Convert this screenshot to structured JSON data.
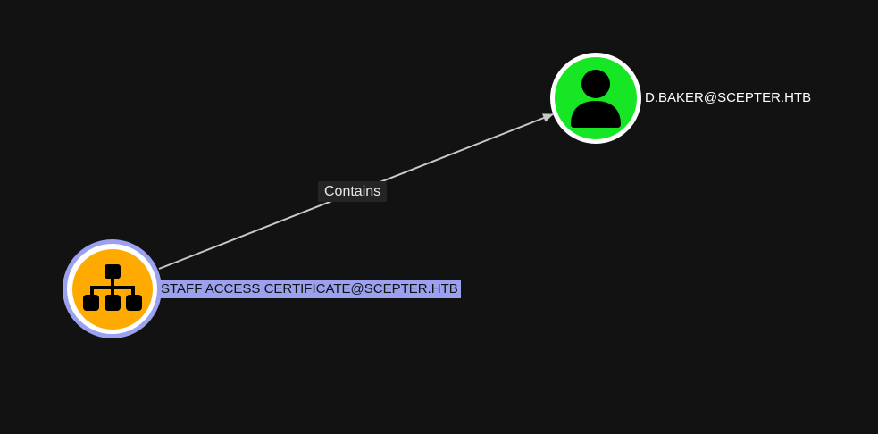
{
  "graph": {
    "nodes": [
      {
        "id": "ou",
        "label": "STAFF ACCESS CERTIFICATE@SCEPTER.HTB",
        "kind": "organizational-unit",
        "icon": "hierarchy-icon",
        "fill_color": "#ffaa00",
        "ring_color": "#9ba1ee",
        "selected": true
      },
      {
        "id": "user",
        "label": "D.BAKER@SCEPTER.HTB",
        "kind": "user",
        "icon": "user-icon",
        "fill_color": "#17e625",
        "ring_color": "#ffffff",
        "selected": false
      }
    ],
    "edges": [
      {
        "source": "ou",
        "target": "user",
        "label": "Contains",
        "color": "#c8c8c8"
      }
    ]
  }
}
